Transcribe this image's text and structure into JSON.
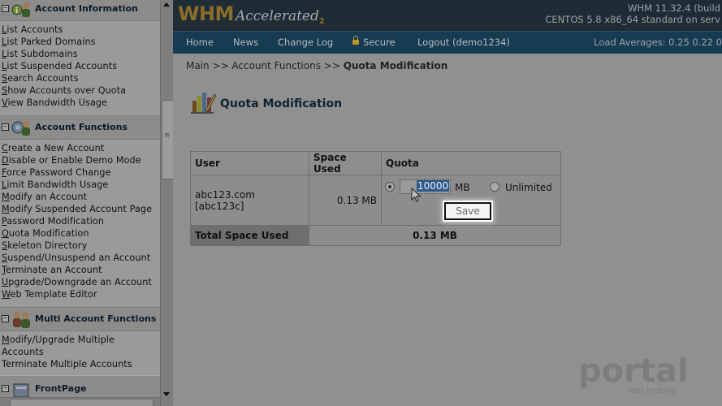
{
  "sidebar": {
    "sections": [
      {
        "title": "Account Information",
        "icon": "account-information-icon",
        "items": [
          {
            "first": "L",
            "rest": "ist Accounts"
          },
          {
            "first": "L",
            "rest": "ist Parked Domains"
          },
          {
            "first": "L",
            "rest": "ist Subdomains"
          },
          {
            "first": "L",
            "rest": "ist Suspended Accounts"
          },
          {
            "first": "S",
            "rest": "earch Accounts"
          },
          {
            "first": "S",
            "rest": "how Accounts over Quota"
          },
          {
            "first": "V",
            "rest": "iew Bandwidth Usage"
          }
        ]
      },
      {
        "title": "Account Functions",
        "icon": "account-functions-icon",
        "items": [
          {
            "first": "C",
            "rest": "reate a New Account"
          },
          {
            "first": "D",
            "rest": "isable or Enable Demo Mode"
          },
          {
            "first": "F",
            "rest": "orce Password Change"
          },
          {
            "first": "L",
            "rest": "imit Bandwidth Usage"
          },
          {
            "first": "M",
            "rest": "odify an Account"
          },
          {
            "first": "M",
            "rest": "odify Suspended Account Page"
          },
          {
            "first": "P",
            "rest": "assword Modification"
          },
          {
            "first": "Q",
            "rest": "uota Modification"
          },
          {
            "first": "S",
            "rest": "keleton Directory"
          },
          {
            "first": "S",
            "rest": "uspend/Unsuspend an Account"
          },
          {
            "first": "T",
            "rest": "erminate an Account"
          },
          {
            "first": "U",
            "rest": "pgrade/Downgrade an Account"
          },
          {
            "first": "W",
            "rest": "eb Template Editor"
          }
        ]
      },
      {
        "title": "Multi Account Functions",
        "icon": "multi-account-functions-icon",
        "items": [
          {
            "first": "M",
            "rest": "odify/Upgrade Multiple"
          },
          {
            "first": "",
            "rest": "Accounts"
          },
          {
            "first": "",
            "rest": "Terminate Multiple Accounts"
          }
        ]
      },
      {
        "title": "FrontPage",
        "icon": "frontpage-icon",
        "items": []
      }
    ]
  },
  "header": {
    "logo": {
      "brand": "WHM",
      "product": "Accelerated",
      "version_mark": "2"
    },
    "version_line1": "WHM 11.32.4 (build",
    "version_line2": "CENTOS 5.8 x86_64 standard on serv",
    "nav": [
      "Home",
      "News",
      "Change Log",
      "Secure",
      "Logout (demo1234)"
    ],
    "load_averages": "Load Averages: 0.25 0.22 0"
  },
  "main": {
    "breadcrumb": {
      "path": "Main >> Account Functions >> ",
      "current": "Quota Modification"
    },
    "title": "Quota Modification",
    "table": {
      "headers": [
        "User",
        "Space Used",
        "Quota"
      ],
      "row": {
        "user": "abc123.com [abc123c]",
        "space_used": "0.13 MB",
        "quota_value": "10000",
        "quota_unit": "MB",
        "unlimited_label": "Unlimited",
        "save_label": "Save"
      },
      "total_label": "Total Space Used",
      "total_value": "0.13 MB"
    }
  },
  "watermark": {
    "text": "portal",
    "sub": "web hosting"
  }
}
